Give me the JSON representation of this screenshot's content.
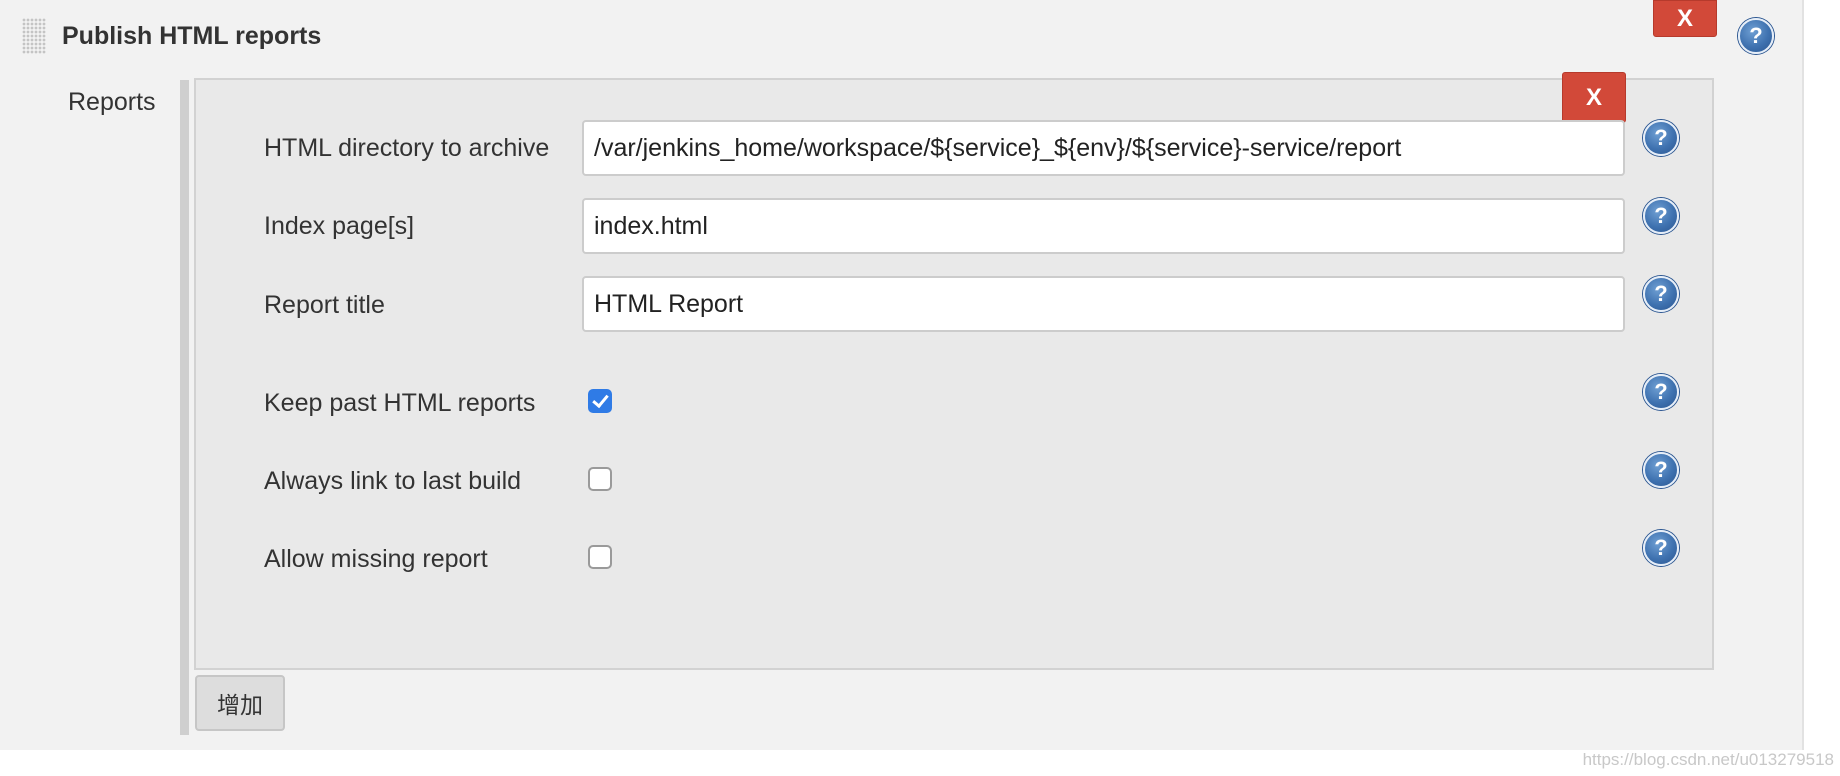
{
  "section": {
    "title": "Publish HTML reports",
    "delete_label": "X"
  },
  "reports": {
    "label": "Reports",
    "delete_label": "X",
    "fields": {
      "html_directory": {
        "label": "HTML directory to archive",
        "value": "/var/jenkins_home/workspace/${service}_${env}/${service}-service/report"
      },
      "index_pages": {
        "label": "Index page[s]",
        "value": "index.html"
      },
      "report_title": {
        "label": "Report title",
        "value": "HTML Report"
      }
    },
    "options": {
      "keep_past": {
        "label": "Keep past HTML reports",
        "checked": true
      },
      "always_link": {
        "label": "Always link to last build",
        "checked": false
      },
      "allow_missing": {
        "label": "Allow missing report",
        "checked": false
      }
    },
    "add_label": "增加"
  },
  "help_glyph": "?",
  "icons": {
    "help": "help-question-icon",
    "drag": "drag-handle-icon"
  },
  "colors": {
    "delete_button": "#d24939",
    "help_icon": "#3f72b0",
    "checkbox_checked": "#2f7be6"
  },
  "watermark": "https://blog.csdn.net/u013279518"
}
